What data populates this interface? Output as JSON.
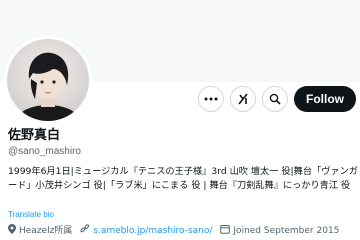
{
  "profile": {
    "display_name": "佐野真白",
    "handle": "@sano_mashiro",
    "bio": "1999年6月1日|ミュージカル『テニスの王子様』3rd 山吹 壇太一 役|舞台「ヴァンガード」小茂井シンゴ 役|「ラブ米」にこまる 役 | 舞台『刀剣乱舞』にっかり青江 役",
    "translate_label": "Translate bio",
    "affiliation": "Heazelz所属",
    "website": "s.ameblo.jp/mashiro-sano/",
    "joined": "Joined September 2015"
  },
  "actions": {
    "more_icon": "more-icon",
    "grok_icon": "grok-icon",
    "search_icon": "search-icon",
    "follow_label": "Follow"
  },
  "colors": {
    "accent": "#1d9bf0",
    "text": "#0f1419",
    "muted": "#536471",
    "follow_bg": "#0f1419"
  }
}
